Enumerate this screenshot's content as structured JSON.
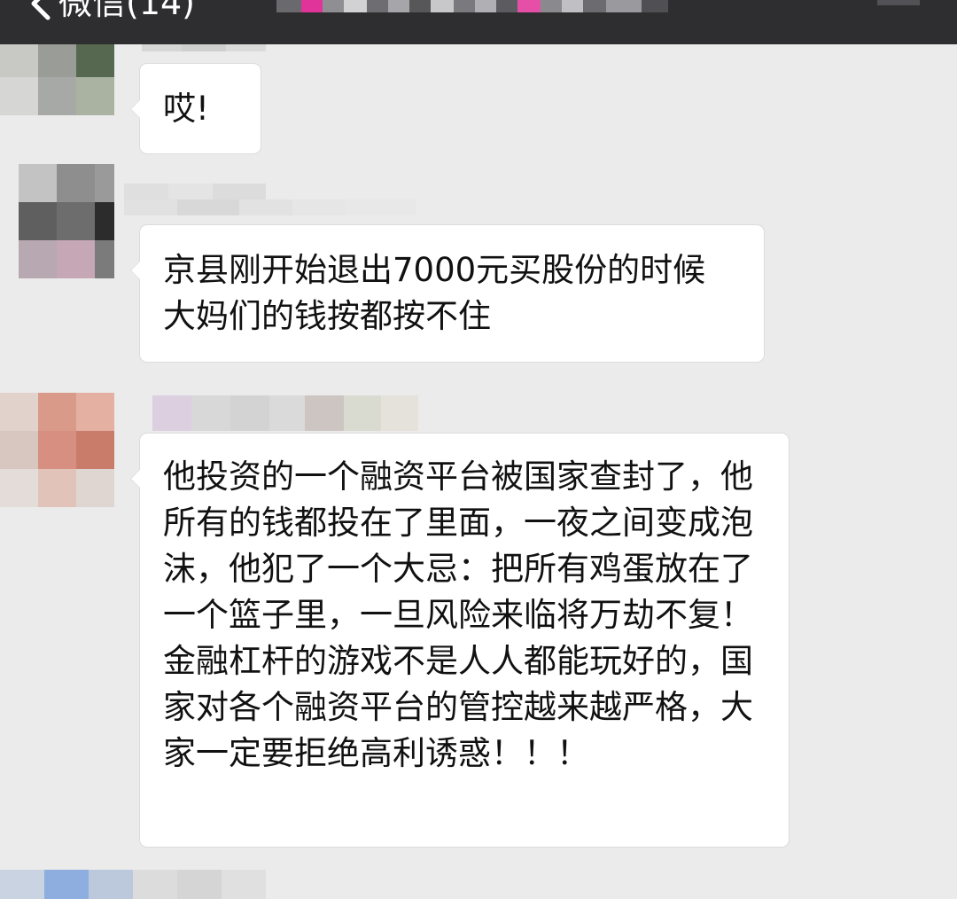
{
  "header": {
    "back_label": "微信(14)",
    "background": "#2e2e31",
    "title_obscured": true
  },
  "chat": {
    "background": "#ebebeb",
    "messages": [
      {
        "sender_obscured": true,
        "text": "哎!"
      },
      {
        "sender_obscured": true,
        "text": "京县刚开始退出7000元买股份的时候  大妈们的钱按都按不住"
      },
      {
        "sender_obscured": true,
        "text": "他投资的一个融资平台被国家查封了，他所有的钱都投在了里面，一夜之间变成泡沫，他犯了一个大忌：把所有鸡蛋放在了一个篮子里，一旦风险来临将万劫不复！金融杠杆的游戏不是人人都能玩好的，国家对各个融资平台的管控越来越严格，大家一定要拒绝高利诱惑！！！"
      }
    ]
  }
}
